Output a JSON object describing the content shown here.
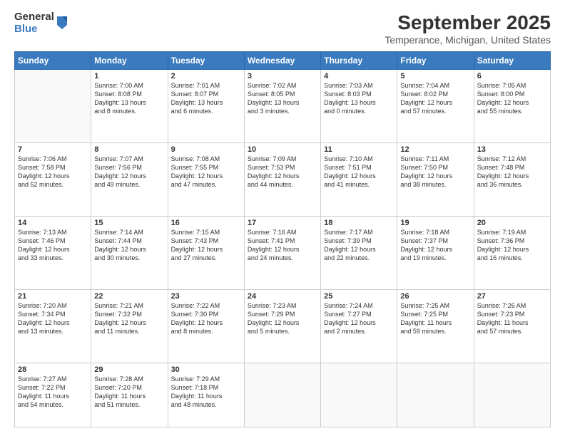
{
  "logo": {
    "general": "General",
    "blue": "Blue"
  },
  "title": "September 2025",
  "subtitle": "Temperance, Michigan, United States",
  "days_of_week": [
    "Sunday",
    "Monday",
    "Tuesday",
    "Wednesday",
    "Thursday",
    "Friday",
    "Saturday"
  ],
  "weeks": [
    [
      {
        "day": "",
        "info": ""
      },
      {
        "day": "1",
        "info": "Sunrise: 7:00 AM\nSunset: 8:08 PM\nDaylight: 13 hours\nand 8 minutes."
      },
      {
        "day": "2",
        "info": "Sunrise: 7:01 AM\nSunset: 8:07 PM\nDaylight: 13 hours\nand 6 minutes."
      },
      {
        "day": "3",
        "info": "Sunrise: 7:02 AM\nSunset: 8:05 PM\nDaylight: 13 hours\nand 3 minutes."
      },
      {
        "day": "4",
        "info": "Sunrise: 7:03 AM\nSunset: 8:03 PM\nDaylight: 13 hours\nand 0 minutes."
      },
      {
        "day": "5",
        "info": "Sunrise: 7:04 AM\nSunset: 8:02 PM\nDaylight: 12 hours\nand 57 minutes."
      },
      {
        "day": "6",
        "info": "Sunrise: 7:05 AM\nSunset: 8:00 PM\nDaylight: 12 hours\nand 55 minutes."
      }
    ],
    [
      {
        "day": "7",
        "info": "Sunrise: 7:06 AM\nSunset: 7:58 PM\nDaylight: 12 hours\nand 52 minutes."
      },
      {
        "day": "8",
        "info": "Sunrise: 7:07 AM\nSunset: 7:56 PM\nDaylight: 12 hours\nand 49 minutes."
      },
      {
        "day": "9",
        "info": "Sunrise: 7:08 AM\nSunset: 7:55 PM\nDaylight: 12 hours\nand 47 minutes."
      },
      {
        "day": "10",
        "info": "Sunrise: 7:09 AM\nSunset: 7:53 PM\nDaylight: 12 hours\nand 44 minutes."
      },
      {
        "day": "11",
        "info": "Sunrise: 7:10 AM\nSunset: 7:51 PM\nDaylight: 12 hours\nand 41 minutes."
      },
      {
        "day": "12",
        "info": "Sunrise: 7:11 AM\nSunset: 7:50 PM\nDaylight: 12 hours\nand 38 minutes."
      },
      {
        "day": "13",
        "info": "Sunrise: 7:12 AM\nSunset: 7:48 PM\nDaylight: 12 hours\nand 36 minutes."
      }
    ],
    [
      {
        "day": "14",
        "info": "Sunrise: 7:13 AM\nSunset: 7:46 PM\nDaylight: 12 hours\nand 33 minutes."
      },
      {
        "day": "15",
        "info": "Sunrise: 7:14 AM\nSunset: 7:44 PM\nDaylight: 12 hours\nand 30 minutes."
      },
      {
        "day": "16",
        "info": "Sunrise: 7:15 AM\nSunset: 7:43 PM\nDaylight: 12 hours\nand 27 minutes."
      },
      {
        "day": "17",
        "info": "Sunrise: 7:16 AM\nSunset: 7:41 PM\nDaylight: 12 hours\nand 24 minutes."
      },
      {
        "day": "18",
        "info": "Sunrise: 7:17 AM\nSunset: 7:39 PM\nDaylight: 12 hours\nand 22 minutes."
      },
      {
        "day": "19",
        "info": "Sunrise: 7:18 AM\nSunset: 7:37 PM\nDaylight: 12 hours\nand 19 minutes."
      },
      {
        "day": "20",
        "info": "Sunrise: 7:19 AM\nSunset: 7:36 PM\nDaylight: 12 hours\nand 16 minutes."
      }
    ],
    [
      {
        "day": "21",
        "info": "Sunrise: 7:20 AM\nSunset: 7:34 PM\nDaylight: 12 hours\nand 13 minutes."
      },
      {
        "day": "22",
        "info": "Sunrise: 7:21 AM\nSunset: 7:32 PM\nDaylight: 12 hours\nand 11 minutes."
      },
      {
        "day": "23",
        "info": "Sunrise: 7:22 AM\nSunset: 7:30 PM\nDaylight: 12 hours\nand 8 minutes."
      },
      {
        "day": "24",
        "info": "Sunrise: 7:23 AM\nSunset: 7:29 PM\nDaylight: 12 hours\nand 5 minutes."
      },
      {
        "day": "25",
        "info": "Sunrise: 7:24 AM\nSunset: 7:27 PM\nDaylight: 12 hours\nand 2 minutes."
      },
      {
        "day": "26",
        "info": "Sunrise: 7:25 AM\nSunset: 7:25 PM\nDaylight: 11 hours\nand 59 minutes."
      },
      {
        "day": "27",
        "info": "Sunrise: 7:26 AM\nSunset: 7:23 PM\nDaylight: 11 hours\nand 57 minutes."
      }
    ],
    [
      {
        "day": "28",
        "info": "Sunrise: 7:27 AM\nSunset: 7:22 PM\nDaylight: 11 hours\nand 54 minutes."
      },
      {
        "day": "29",
        "info": "Sunrise: 7:28 AM\nSunset: 7:20 PM\nDaylight: 11 hours\nand 51 minutes."
      },
      {
        "day": "30",
        "info": "Sunrise: 7:29 AM\nSunset: 7:18 PM\nDaylight: 11 hours\nand 48 minutes."
      },
      {
        "day": "",
        "info": ""
      },
      {
        "day": "",
        "info": ""
      },
      {
        "day": "",
        "info": ""
      },
      {
        "day": "",
        "info": ""
      }
    ]
  ]
}
